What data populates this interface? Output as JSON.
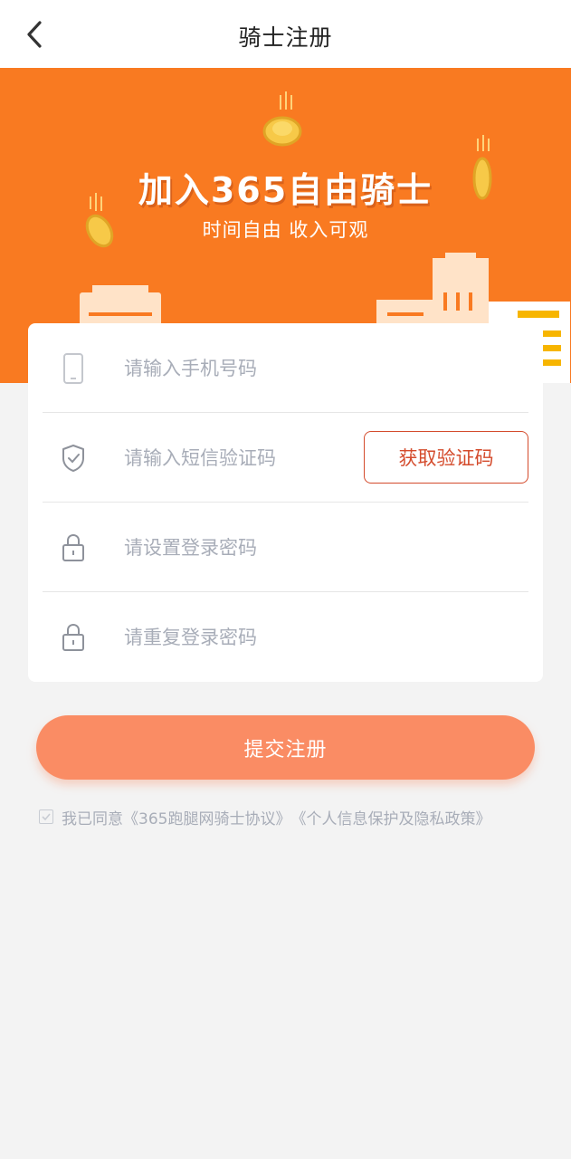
{
  "nav": {
    "title": "骑士注册"
  },
  "banner": {
    "title": "加入365自由骑士",
    "subtitle": "时间自由  收入可观"
  },
  "form": {
    "phone": {
      "placeholder": "请输入手机号码",
      "icon": "phone-icon"
    },
    "sms": {
      "placeholder": "请输入短信验证码",
      "icon": "shield-check-icon",
      "button_label": "获取验证码"
    },
    "password": {
      "placeholder": "请设置登录密码",
      "icon": "lock-icon"
    },
    "password_repeat": {
      "placeholder": "请重复登录密码",
      "icon": "lock-icon"
    }
  },
  "submit": {
    "label": "提交注册"
  },
  "agreement": {
    "prefix": "我已同意",
    "rider_agreement": "《365跑腿网骑士协议》",
    "privacy_policy": "《个人信息保护及隐私政策》",
    "checked": true
  },
  "colors": {
    "accent": "#f97a21",
    "button": "#fa8c64",
    "code_button": "#d44b2c"
  }
}
